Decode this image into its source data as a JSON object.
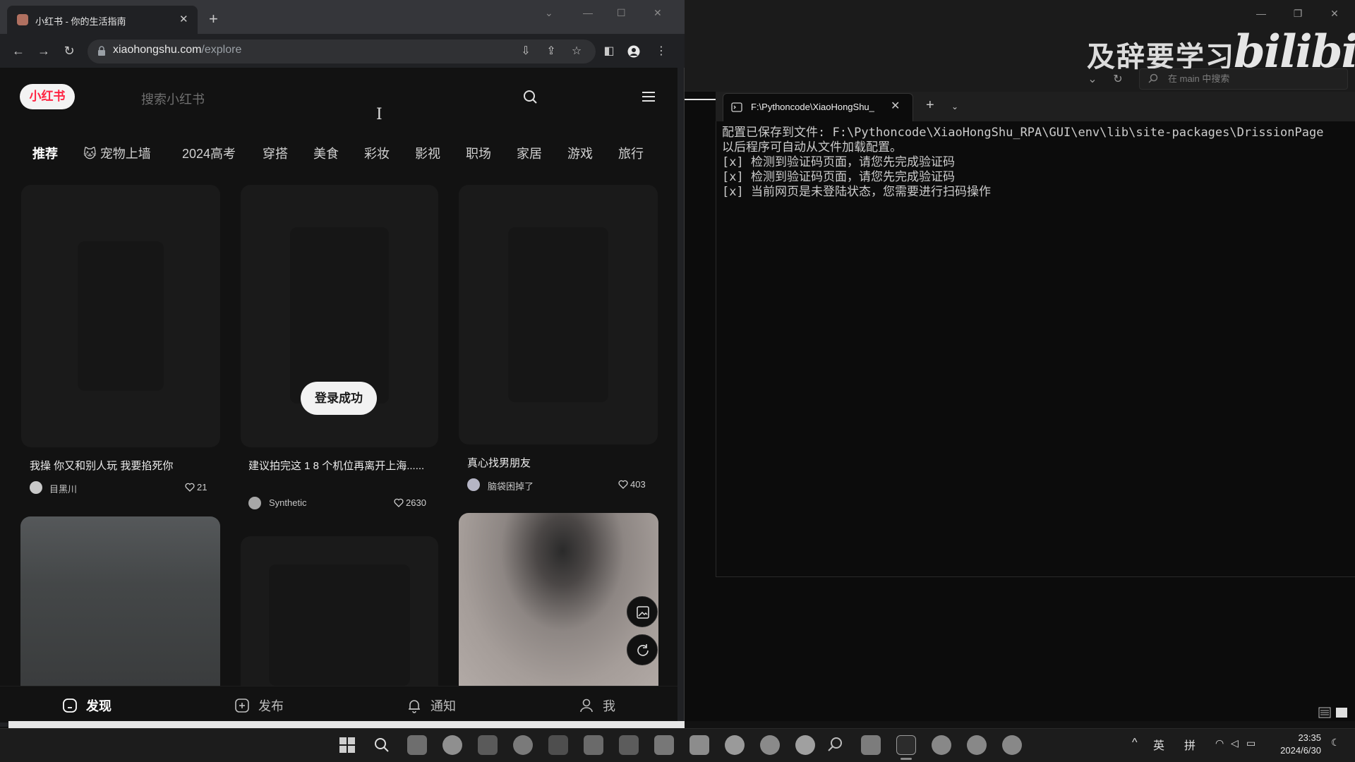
{
  "browser": {
    "tab_title": "小红书 - 你的生活指南",
    "url_host": "xiaohongshu.com",
    "url_path": "/explore"
  },
  "site": {
    "logo": "小红书",
    "search_placeholder": "搜索小红书",
    "channels": [
      "推荐",
      "宠物上墙",
      "2024高考",
      "穿搭",
      "美食",
      "彩妆",
      "影视",
      "职场",
      "家居",
      "游戏",
      "旅行"
    ],
    "cards": [
      {
        "title": "我操 你又和别人玩 我要掐死你",
        "author": "目黑川",
        "likes": "21"
      },
      {
        "title": "建议拍完这 1 8 个机位再离开上海......",
        "author": "Synthetic",
        "likes": "2630"
      },
      {
        "title": "真心找男朋友",
        "author": "脑袋困掉了",
        "likes": "403"
      }
    ],
    "toast": "登录成功",
    "bottom_nav": [
      "发现",
      "发布",
      "通知",
      "我"
    ]
  },
  "terminal": {
    "tab_label": "F:\\Pythoncode\\XiaoHongShu_",
    "search_placeholder": "在 main 中搜索",
    "lines": [
      "配置已保存到文件: F:\\Pythoncode\\XiaoHongShu_RPA\\GUI\\env\\lib\\site-packages\\DrissionPage",
      "以后程序可自动从文件加载配置。",
      "[x] 检测到验证码页面，请您先完成验证码",
      "[x] 检测到验证码页面，请您先完成验证码",
      "[x] 当前网页是未登陆状态，您需要进行扫码操作"
    ]
  },
  "watermark": {
    "text": "及辞要学习",
    "logo": "bilibili"
  },
  "taskbar": {
    "ime_lang": "英",
    "ime_mode": "拼",
    "time": "23:35",
    "date": "2024/6/30"
  }
}
